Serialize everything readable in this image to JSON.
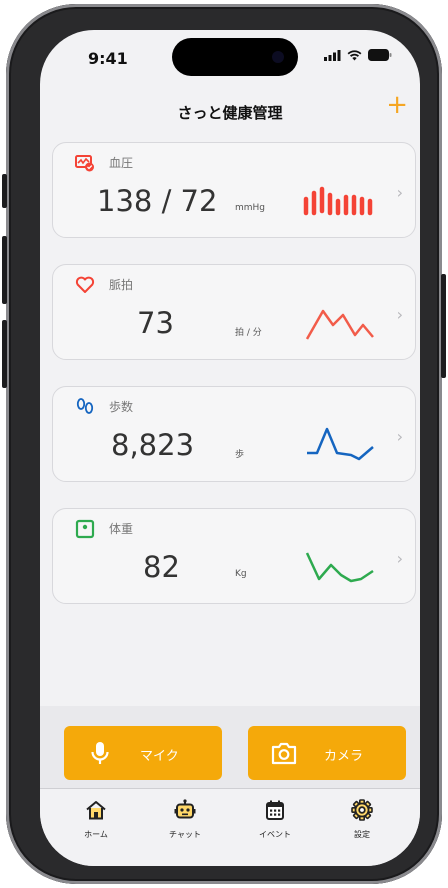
{
  "status_bar": {
    "time": "9:41"
  },
  "header": {
    "title": "さっと健康管理",
    "add_label": "+"
  },
  "cards": [
    {
      "label": "血圧",
      "value": "138 / 72",
      "unit": "mmHg",
      "color": "#f44336",
      "icon": "blood-pressure-icon"
    },
    {
      "label": "脈拍",
      "value": "73",
      "unit": "拍 / 分",
      "color": "#f44336",
      "icon": "heart-icon"
    },
    {
      "label": "歩数",
      "value": "8,823",
      "unit": "歩",
      "color": "#1565c0",
      "icon": "footprints-icon"
    },
    {
      "label": "体重",
      "value": "82",
      "unit": "Kg",
      "color": "#2eaa4f",
      "icon": "scale-icon"
    }
  ],
  "actions": {
    "mic_label": "マイク",
    "camera_label": "カメラ",
    "accent": "#f5a90a"
  },
  "tabs": [
    {
      "label": "ホーム",
      "icon": "home-icon"
    },
    {
      "label": "チャット",
      "icon": "robot-icon"
    },
    {
      "label": "イベント",
      "icon": "calendar-icon"
    },
    {
      "label": "設定",
      "icon": "gear-icon"
    }
  ],
  "chevron": "›"
}
